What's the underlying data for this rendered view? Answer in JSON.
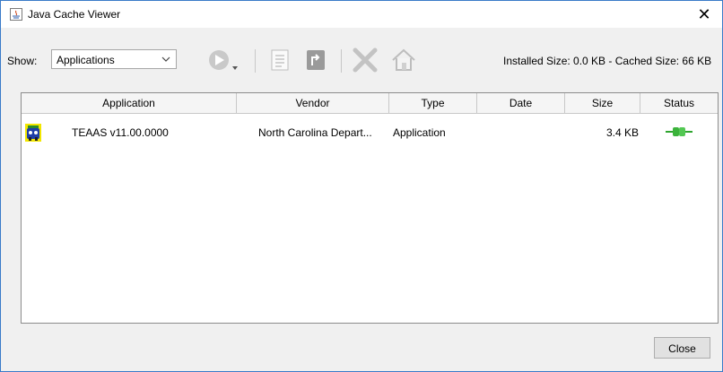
{
  "window": {
    "title": "Java Cache Viewer",
    "close_glyph": "✕"
  },
  "toolbar": {
    "show_label": "Show:",
    "show_selected": "Applications",
    "size_info": "Installed Size: 0.0 KB - Cached Size: 66 KB",
    "icons": [
      "run-online-icon",
      "show-jnlp-icon",
      "install-shortcut-icon",
      "delete-icon",
      "home-icon"
    ]
  },
  "table": {
    "headers": [
      "Application",
      "Vendor",
      "Type",
      "Date",
      "Size",
      "Status"
    ],
    "rows": [
      {
        "application": "TEAAS v11.00.0000",
        "vendor": "North Carolina Depart...",
        "type": "Application",
        "date": "",
        "size": "3.4 KB",
        "status_icon": "network-plug-icon"
      }
    ]
  },
  "footer": {
    "close_label": "Close"
  },
  "colors": {
    "accent": "#3a7bc8",
    "status_green": "#3bb33b"
  }
}
